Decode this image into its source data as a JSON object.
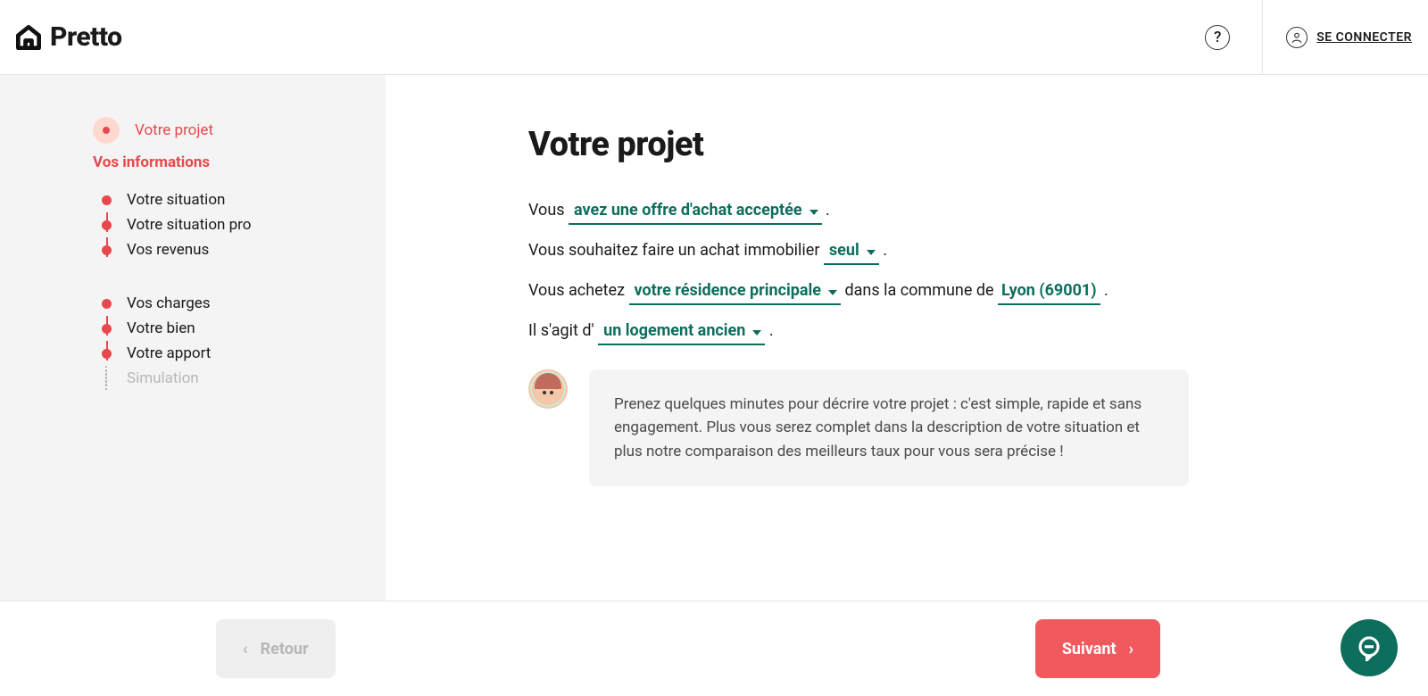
{
  "brand": {
    "name": "Pretto"
  },
  "header": {
    "login_label": "SE CONNECTER"
  },
  "sidebar": {
    "section_label": "Vos informations",
    "items": [
      {
        "label": "Votre projet"
      },
      {
        "label": "Votre situation"
      },
      {
        "label": "Votre situation pro"
      },
      {
        "label": "Vos revenus"
      },
      {
        "label": "Vos charges"
      },
      {
        "label": "Votre bien"
      },
      {
        "label": "Votre apport"
      },
      {
        "label": "Simulation"
      }
    ]
  },
  "main": {
    "title": "Votre projet",
    "line1": {
      "pre": "Vous ",
      "select": "avez une offre d'achat acceptée",
      "post": " ."
    },
    "line2": {
      "pre": "Vous souhaitez faire un achat immobilier ",
      "select": "seul",
      "post": " ."
    },
    "line3": {
      "pre": "Vous achetez ",
      "select": "votre résidence principale",
      "mid": " dans la commune de ",
      "city": "Lyon (69001)",
      "post": " ."
    },
    "line4": {
      "pre": "Il s'agit d' ",
      "select": "un logement ancien",
      "post": " ."
    },
    "info": "Prenez quelques minutes pour décrire votre projet : c'est simple, rapide et sans engagement. Plus vous serez complet dans la description de votre situation et plus notre comparaison des meilleurs taux pour vous sera précise !"
  },
  "footer": {
    "back": "Retour",
    "next": "Suivant"
  }
}
